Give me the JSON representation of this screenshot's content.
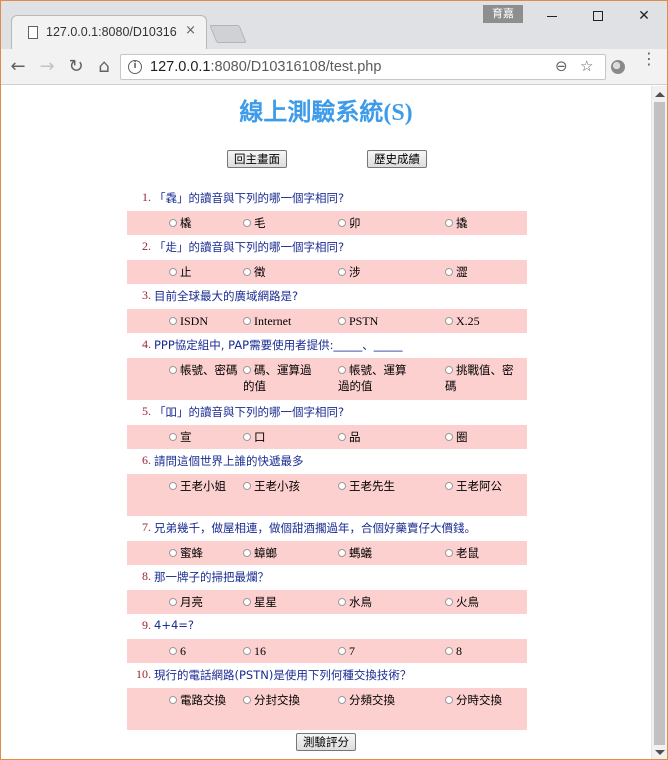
{
  "browser": {
    "tab_title": "127.0.0.1:8080/D10316",
    "tab_close": "×",
    "user_badge": "育嘉",
    "url_host": "127.0.0.1",
    "url_rest": ":8080/D10316108/test.php",
    "icons": {
      "back": "back-arrow-icon",
      "forward": "forward-arrow-icon",
      "reload": "reload-icon",
      "home": "home-icon",
      "info": "info-icon",
      "zoom": "zoom-icon",
      "star": "star-icon",
      "extension": "extension-icon",
      "menu": "menu-icon"
    }
  },
  "page": {
    "title": "線上測驗系統(S)",
    "home_button": "回主畫面",
    "history_button": "歷史成績",
    "submit_button": "測驗評分"
  },
  "questions": [
    {
      "num": "1.",
      "text": "「毳」的讀音與下列的哪一個字相同?",
      "options": [
        "橇",
        "毛",
        "卯",
        "撬"
      ]
    },
    {
      "num": "2.",
      "text": "「歨」的讀音與下列的哪一個字相同?",
      "options": [
        "止",
        "徵",
        "涉",
        "澀"
      ]
    },
    {
      "num": "3.",
      "text": "目前全球最大的廣域網路是?",
      "options": [
        "ISDN",
        "Internet",
        "PSTN",
        "X.25"
      ]
    },
    {
      "num": "4.",
      "text": "PPP協定組中, PAP需要使用者提供:_____、_____",
      "options": [
        "帳號、密碼",
        "碼、運算過的值",
        "帳號、運算過的值",
        "挑戰值、密碼"
      ]
    },
    {
      "num": "5.",
      "text": "「吅」的讀音與下列的哪一個字相同?",
      "options": [
        "宣",
        "口",
        "品",
        "圈"
      ]
    },
    {
      "num": "6.",
      "text": "請問這個世界上誰的快遞最多",
      "options": [
        "王老小姐",
        "王老小孩",
        "王老先生",
        "王老阿公"
      ]
    },
    {
      "num": "7.",
      "text": "兄弟幾千，做屋相連，做個甜酒擱過年，合個好藥賣仔大價錢。",
      "options": [
        "蜜蜂",
        "蟑螂",
        "螞蟻",
        "老鼠"
      ]
    },
    {
      "num": "8.",
      "text": "那一牌子的掃把最爛？",
      "options": [
        "月亮",
        "星星",
        "水鳥",
        "火鳥"
      ]
    },
    {
      "num": "9.",
      "text": "4+4=?",
      "options": [
        "6",
        "16",
        "7",
        "8"
      ]
    },
    {
      "num": "10.",
      "text": "現行的電話網路(PSTN)是使用下列何種交換技術？",
      "options": [
        "電路交換",
        "分封交換",
        "分頻交換",
        "分時交換"
      ]
    }
  ]
}
